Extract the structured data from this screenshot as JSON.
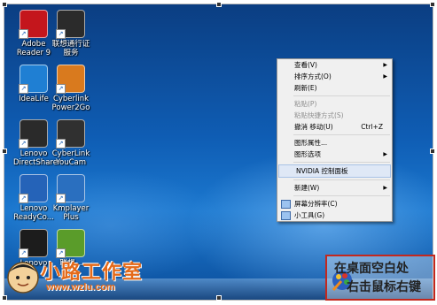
{
  "desktop": {
    "icons": [
      {
        "name": "adobe-reader-icon",
        "lines": [
          "Adobe",
          "Reader 9"
        ],
        "color": "#c4161c"
      },
      {
        "name": "lenovo-id-service-icon",
        "lines": [
          "联想通行证",
          "服务"
        ],
        "color": "#2b2b2b"
      },
      {
        "name": "idealife-icon",
        "lines": [
          "IdeaLife"
        ],
        "color": "#1f7fd3"
      },
      {
        "name": "cyberlink-power2go-icon",
        "lines": [
          "Cyberlink",
          "Power2Go"
        ],
        "color": "#d97a1e"
      },
      {
        "name": "lenovo-directshare-icon",
        "lines": [
          "Lenovo",
          "DirectShare"
        ],
        "color": "#2a2a2a"
      },
      {
        "name": "cyberlink-youcam-icon",
        "lines": [
          "CyberLink",
          "YouCam"
        ],
        "color": "#303030"
      },
      {
        "name": "lenovo-readycomm-icon",
        "lines": [
          "Lenovo",
          "ReadyCo..."
        ],
        "color": "#2563b8"
      },
      {
        "name": "kmplayer-icon",
        "lines": [
          "Kmplayer",
          "Plus"
        ],
        "color": "#2a6fbf"
      },
      {
        "name": "lenovo-lock-icon",
        "lines": [
          "Lenovo"
        ],
        "color": "#1c1c1c"
      },
      {
        "name": "download-app-icon",
        "lines": [
          "联想..."
        ],
        "color": "#5a9c2a"
      }
    ]
  },
  "context_menu": {
    "items": [
      {
        "label": "查看(V)",
        "submenu": true
      },
      {
        "label": "排序方式(O)",
        "submenu": true
      },
      {
        "label": "刷新(E)"
      },
      {
        "sep": true
      },
      {
        "label": "粘贴(P)",
        "disabled": true
      },
      {
        "label": "粘贴快捷方式(S)",
        "disabled": true
      },
      {
        "label": "撤消 移动(U)",
        "shortcut": "Ctrl+Z"
      },
      {
        "sep": true
      },
      {
        "label": "图形属性..."
      },
      {
        "label": "图形选项",
        "submenu": true
      },
      {
        "sep": true
      },
      {
        "label": "NVIDIA 控制面板",
        "highlight": true
      },
      {
        "sep": true
      },
      {
        "label": "新建(W)",
        "submenu": true
      },
      {
        "sep": true
      },
      {
        "label": "屏幕分辨率(C)",
        "icon": true
      },
      {
        "label": "小工具(G)",
        "icon": true
      }
    ]
  },
  "watermark": {
    "site_name": "小路工作室",
    "url": "www.wzlu.com"
  },
  "annotation": {
    "line1": "在桌面空白处",
    "line2": "右击鼠标右键"
  }
}
